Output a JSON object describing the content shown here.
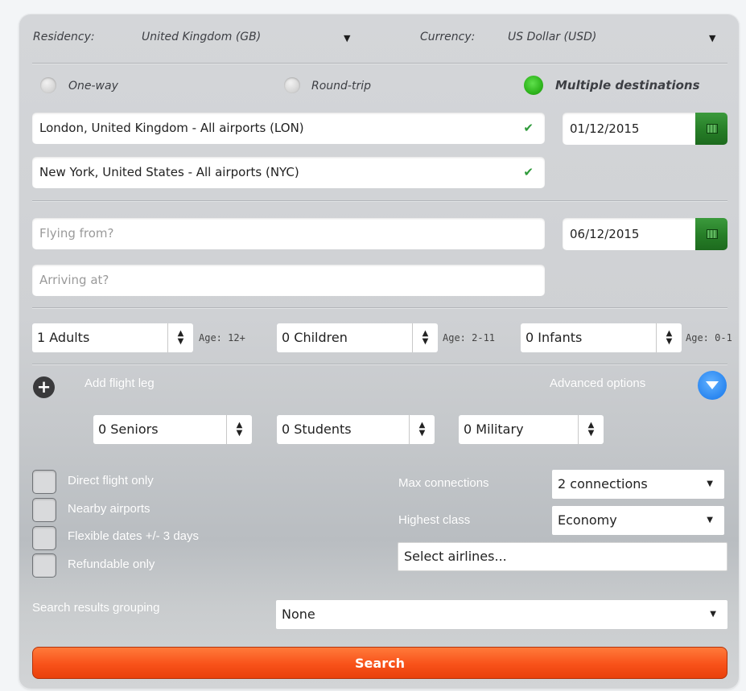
{
  "header": {
    "residency_label": "Residency:",
    "residency_value": "United Kingdom (GB)",
    "currency_label": "Currency:",
    "currency_value": "US Dollar (USD)"
  },
  "trip_type": {
    "one_way": "One-way",
    "round_trip": "Round-trip",
    "multiple": "Multiple destinations",
    "selected": "multiple"
  },
  "leg1": {
    "from": "London, United Kingdom - All airports (LON)",
    "to": "New York, United States - All airports (NYC)",
    "date": "01/12/2015"
  },
  "leg2": {
    "from_placeholder": "Flying from?",
    "to_placeholder": "Arriving at?",
    "date": "06/12/2015"
  },
  "passengers": {
    "adults": "1 Adults",
    "adults_age": "Age: 12+",
    "children": "0 Children",
    "children_age": "Age: 2-11",
    "infants": "0 Infants",
    "infants_age": "Age: 0-1"
  },
  "actions": {
    "add_leg": "Add flight leg",
    "advanced": "Advanced options"
  },
  "advanced": {
    "seniors": "0 Seniors",
    "students": "0 Students",
    "military": "0 Military",
    "checkboxes": [
      "Direct flight only",
      "Nearby airports",
      "Flexible dates +/- 3 days",
      "Refundable only"
    ],
    "max_connections_label": "Max connections",
    "max_connections_value": "2 connections",
    "highest_class_label": "Highest class",
    "highest_class_value": "Economy",
    "airlines_placeholder": "Select airlines..."
  },
  "grouping": {
    "label": "Search results grouping",
    "value": "None"
  },
  "search_button": "Search",
  "colors": {
    "accent_green": "#2fb51d",
    "search_orange": "#f8521a",
    "advanced_blue": "#2a86f0"
  }
}
